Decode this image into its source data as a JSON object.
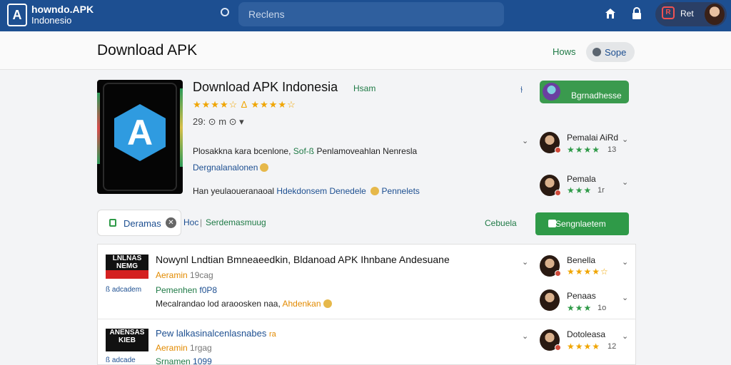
{
  "topbar": {
    "logo_letter": "A",
    "brand_line1": "howndo.APK",
    "brand_line2": "Indonesio",
    "search_placeholder": "Reclens",
    "user_badge": "R",
    "user_name": "Ret",
    "colors": {
      "bar": "#1d4f91",
      "search": "#2f5f9e"
    }
  },
  "header": {
    "title": "Download APK",
    "nav_home": "Hows",
    "nav_sope": "Sope"
  },
  "app": {
    "icon_letter": "A",
    "title": "Download APK Indonesia",
    "tag": "Hsam",
    "rating_stars": "★★★★☆ ∆ ★★★★☆",
    "meta": "29: ⊙ m ⊙ ▾",
    "desc1_a": "Plosakkna kara bcenlone, ",
    "desc1_b": "Sof-ß ",
    "desc1_c": "Penlamoveahlan Nenresla",
    "desc2": "Dergnalanalonen",
    "desc3_a": "Han yeulaoueranaoal ",
    "desc3_b": "Hdekdonsem Denedele",
    "desc3_c": "Pennelets",
    "pin": "⫮",
    "top_button": "Bgrnadhesse"
  },
  "reviews_top": [
    {
      "name": "Pemalai AiRd",
      "stars": "★★★★",
      "count": "13"
    },
    {
      "name": "Pemala",
      "stars": "★★★",
      "count": "1r"
    }
  ],
  "actions": {
    "pill_label": "Deramas",
    "pill_close": "✕",
    "hoc": "Hoc",
    "sep": "|",
    "dermas": "Serdemasmuug",
    "cebula": "Cebuela",
    "green_button": "Sengnlaetem"
  },
  "list": [
    {
      "thumb_text": "LNLNAS NEMG",
      "thumb_small": "ß adcadem",
      "title": "Nowynl Lndtian Bmneaeedkin, Bldanoad APK Ihnbane Andesuane",
      "author": "Aeramin",
      "date": "19cag",
      "sub_a": "Pemenhen",
      "sub_b": "f0P8",
      "desc_a": "Mecalrandao lod araoosken naa, ",
      "desc_b": "Ahdenkan"
    },
    {
      "thumb_text": "ANENSAS KIEB",
      "thumb_small": "ß adcade",
      "title": "Pew lalkasinalcenlasnabes",
      "title_suffix": "ra",
      "author": "Aeramin",
      "date": "1rgag",
      "sub_a": "Srnamen",
      "sub_b": "1099"
    }
  ],
  "reviews_list": [
    {
      "name": "Benella",
      "stars": "★★★★☆",
      "count": ""
    },
    {
      "name": "Penaas",
      "stars": "★★★",
      "count": "1o"
    },
    {
      "name": "Dotoleasa",
      "stars": "★★★★",
      "count": "12"
    }
  ]
}
